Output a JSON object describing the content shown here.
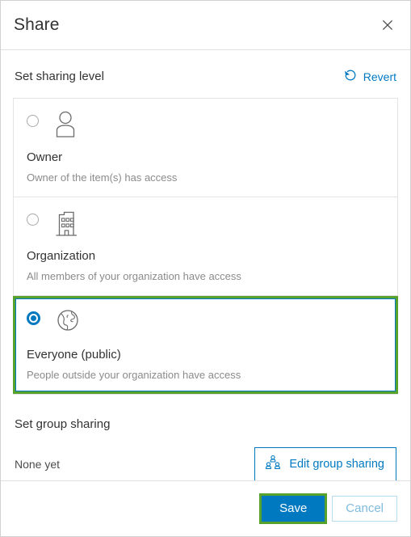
{
  "dialog": {
    "title": "Share",
    "close_icon": "close-icon"
  },
  "sharing_level": {
    "section_title": "Set sharing level",
    "revert_label": "Revert",
    "revert_icon": "revert-circular-arrow-icon",
    "options": [
      {
        "id": "owner",
        "label": "Owner",
        "description": "Owner of the item(s) has access",
        "icon": "person-icon",
        "selected": false,
        "highlighted": false
      },
      {
        "id": "organization",
        "label": "Organization",
        "description": "All members of your organization have access",
        "icon": "building-icon",
        "selected": false,
        "highlighted": false
      },
      {
        "id": "everyone",
        "label": "Everyone (public)",
        "description": "People outside your organization have access",
        "icon": "globe-icon",
        "selected": true,
        "highlighted": true
      }
    ]
  },
  "group_sharing": {
    "section_title": "Set group sharing",
    "none_label": "None yet",
    "edit_button_label": "Edit group sharing",
    "edit_button_icon": "group-people-icon"
  },
  "footer": {
    "save_label": "Save",
    "cancel_label": "Cancel"
  },
  "colors": {
    "accent_blue": "#0079c1",
    "highlight_green": "#57a22c",
    "text_primary": "#323232",
    "text_muted": "#8b8b8b",
    "border": "#e3e3e3"
  }
}
